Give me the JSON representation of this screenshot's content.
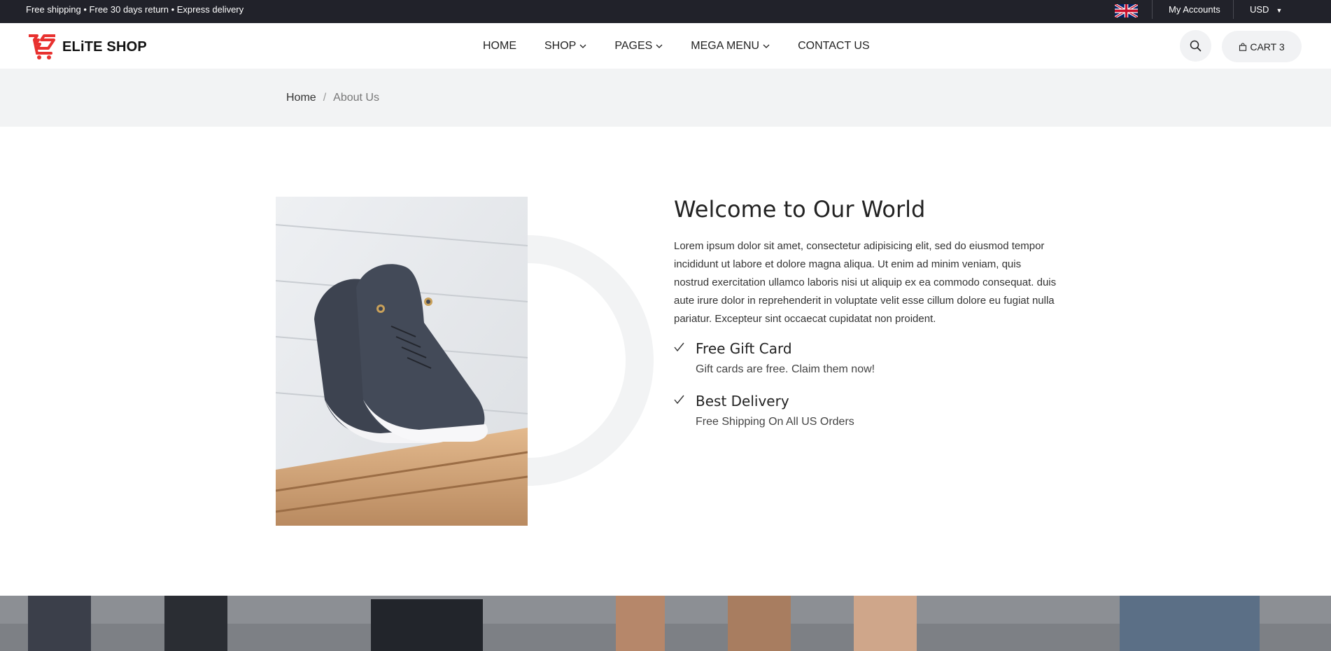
{
  "topbar": {
    "promo": "Free shipping • Free 30 days return • Express delivery",
    "accounts": "My Accounts",
    "currency": "USD",
    "flag_icon": "uk-flag-icon"
  },
  "header": {
    "logo_text": "ELiTE SHOP",
    "logo_icon": "cart-logo-icon",
    "accent_color": "#e8312f",
    "nav": [
      {
        "label": "HOME",
        "dropdown": false
      },
      {
        "label": "SHOP",
        "dropdown": true
      },
      {
        "label": "PAGES",
        "dropdown": true
      },
      {
        "label": "MEGA MENU",
        "dropdown": true
      },
      {
        "label": "CONTACT US",
        "dropdown": false
      }
    ],
    "search_icon": "search-icon",
    "cart_label": "CART 3",
    "cart_icon": "bag-icon"
  },
  "breadcrumb": {
    "home": "Home",
    "separator": "/",
    "current": "About Us"
  },
  "about": {
    "image": "sneakers-photo",
    "title": "Welcome to Our World",
    "lead": "Lorem ipsum dolor sit amet, consectetur adipisicing elit, sed do eiusmod tempor incididunt ut labore et dolore magna aliqua. Ut enim ad minim veniam, quis nostrud exercitation ullamco laboris nisi ut aliquip ex ea commodo consequat. duis aute irure dolor in reprehenderit in voluptate velit esse cillum dolore eu fugiat nulla pariatur. Excepteur sint occaecat cupidatat non proident.",
    "features": [
      {
        "title": "Free Gift Card",
        "desc": "Gift cards are free. Claim them now!"
      },
      {
        "title": "Best Delivery",
        "desc": "Free Shipping On All US Orders"
      }
    ]
  }
}
